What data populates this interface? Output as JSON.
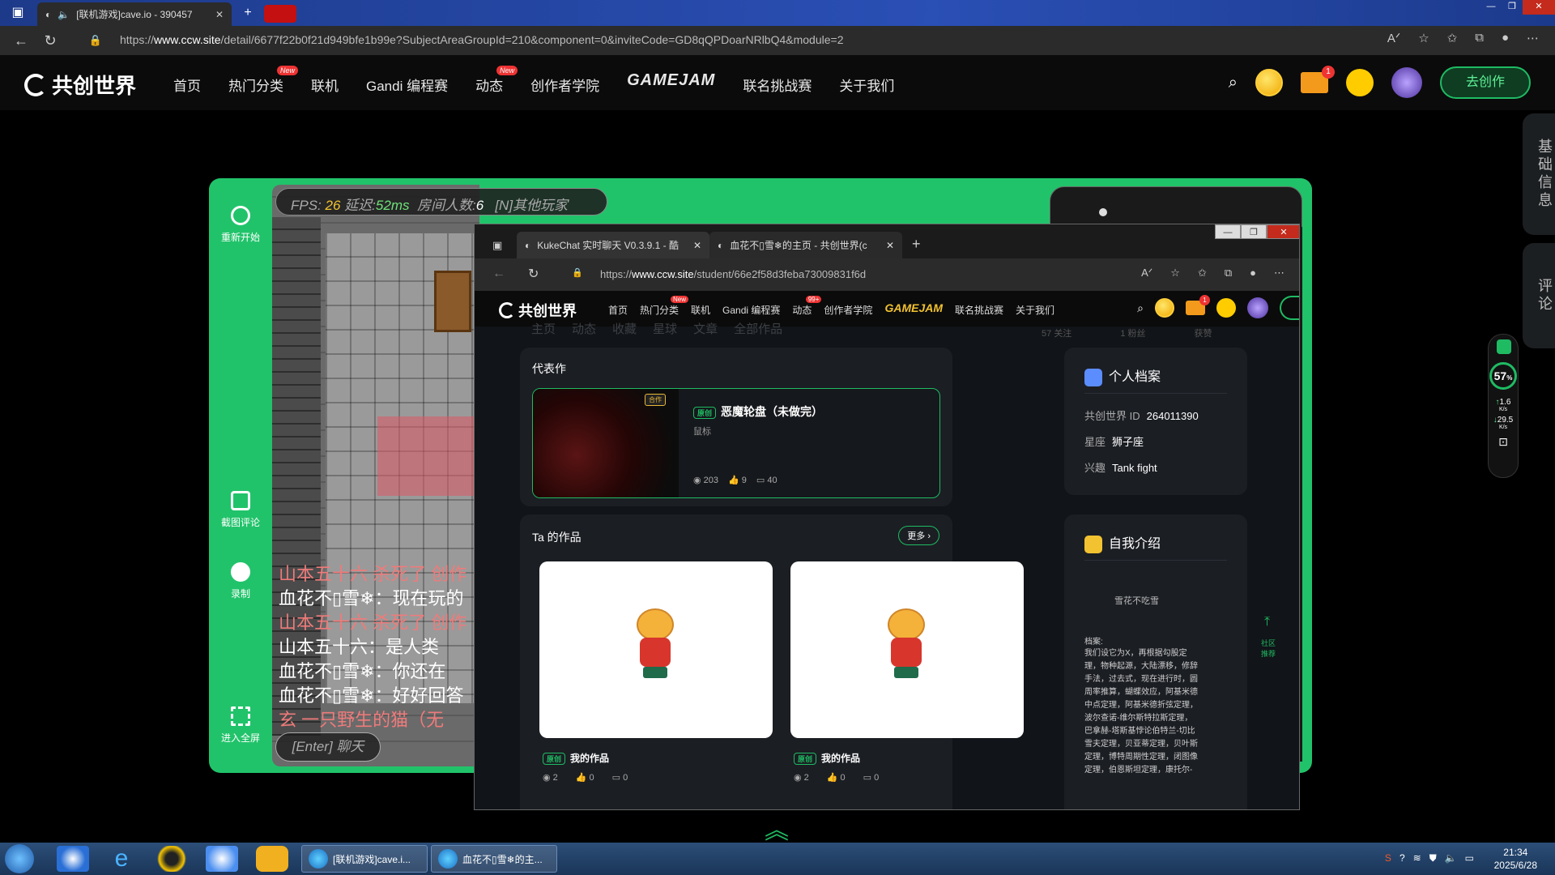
{
  "outer_browser": {
    "tab_title": "[联机游戏]cave.io - 390457",
    "url_prefix": "https://",
    "url_domain": "www.ccw.site",
    "url_path": "/detail/6677f22b0f21d949bfe1b99e?SubjectAreaGroupId=210&component=0&inviteCode=GD8qQPDoarNRlbQ4&module=2"
  },
  "site_header": {
    "logo_text": "共创世界",
    "nav": [
      {
        "label": "首页",
        "badge": ""
      },
      {
        "label": "热门分类",
        "badge": "New"
      },
      {
        "label": "联机",
        "badge": ""
      },
      {
        "label": "Gandi 编程赛",
        "badge": ""
      },
      {
        "label": "动态",
        "badge": "New"
      },
      {
        "label": "创作者学院",
        "badge": ""
      },
      {
        "label": "GAMEJAM",
        "badge": ""
      },
      {
        "label": "联名挑战赛",
        "badge": ""
      },
      {
        "label": "关于我们",
        "badge": ""
      }
    ],
    "mail_count": "1",
    "create_label": "去创作"
  },
  "side_tabs": {
    "basic_info": "基础信息",
    "comments": "评论"
  },
  "game": {
    "tools": [
      {
        "label": "重新开始",
        "icon": "restart-icon"
      },
      {
        "label": "截图评论",
        "icon": "screenshot-icon"
      },
      {
        "label": "录制",
        "icon": "record-icon"
      },
      {
        "label": "进入全屏",
        "icon": "fullscreen-icon"
      }
    ],
    "hud": {
      "fps_label": "FPS:",
      "fps": "26",
      "latency_label": "延迟:",
      "latency": "52ms",
      "room_label": "房间人数:",
      "room_count": "6",
      "other_players": "[N]其他玩家"
    },
    "chat": [
      {
        "text": "山本五十六 杀死了 创作",
        "kill": true
      },
      {
        "text": "血花不▯雪❄：现在玩的",
        "kill": false
      },
      {
        "text": "山本五十六 杀死了 创作",
        "kill": true
      },
      {
        "text": "山本五十六：是人类",
        "kill": false
      },
      {
        "text": "血花不▯雪❄：你还在",
        "kill": false
      },
      {
        "text": "血花不▯雪❄：好好回答",
        "kill": false
      },
      {
        "text": "玄 一只野生的猫（无",
        "kill": true
      }
    ],
    "chat_input": "[Enter] 聊天"
  },
  "inner_browser": {
    "tab1": "KukeChat 实时聊天 V0.3.9.1 - 酷",
    "tab2": "血花不▯雪❄的主页 - 共创世界(c",
    "url_prefix": "https://",
    "url_domain": "www.ccw.site",
    "url_path": "/student/66e2f58d3feba73009831f6d",
    "logo_text": "共创世界",
    "nav": [
      {
        "label": "首页",
        "badge": ""
      },
      {
        "label": "热门分类",
        "badge": "New"
      },
      {
        "label": "联机",
        "badge": ""
      },
      {
        "label": "Gandi 编程赛",
        "badge": ""
      },
      {
        "label": "动态",
        "badge": "99+"
      },
      {
        "label": "创作者学院",
        "badge": ""
      },
      {
        "label": "GAMEJAM",
        "badge": ""
      },
      {
        "label": "联名挑战赛",
        "badge": ""
      },
      {
        "label": "关于我们",
        "badge": ""
      }
    ],
    "mail_count": "1"
  },
  "profile_page": {
    "ghost_tabs": [
      "主页",
      "动态",
      "收藏",
      "星球",
      "文章",
      "全部作品"
    ],
    "ghost_stats": [
      {
        "num": "57",
        "label": "关注"
      },
      {
        "num": "1",
        "label": "粉丝"
      },
      {
        "num": "",
        "label": "获赞"
      }
    ],
    "representative": {
      "title": "代表作",
      "thumb_badge": "合作",
      "tag": "原创",
      "name": "恶魔轮盘（未做完）",
      "category": "鼠标",
      "views": "203",
      "likes": "9",
      "comments": "40"
    },
    "works": {
      "title": "Ta 的作品",
      "more": "更多",
      "items": [
        {
          "tag": "原创",
          "name": "我的作品",
          "views": "2",
          "likes": "0",
          "comments": "0"
        },
        {
          "tag": "原创",
          "name": "我的作品",
          "views": "2",
          "likes": "0",
          "comments": "0"
        }
      ]
    },
    "profile": {
      "title": "个人档案",
      "id_label": "共创世界 ID",
      "id_value": "264011390",
      "zodiac_label": "星座",
      "zodiac_value": "狮子座",
      "hobby_label": "兴趣",
      "hobby_value": "Tank fight"
    },
    "intro": {
      "title": "自我介绍",
      "subtitle": "雪花不吃雪",
      "archive_label": "档案:",
      "text": "我们设它为X，再根据勾股定理，物种起源，大陆漂移，修辞手法，过去式，现在进行时，圆周率推算，蝴蝶效应，阿基米德中点定理，阿基米德折弦定理，波尔查诺-维尔斯特拉斯定理，巴拿赫-塔斯基悖论伯特兰-切比雪夫定理，贝亚蒂定理，贝叶斯定理，博特周期性定理，闭图像定理，伯恩斯坦定理，康托尔-"
    }
  },
  "float_widget": {
    "percent": "57",
    "percent_unit": "%",
    "up": "1.6",
    "up_unit": "K/s",
    "down": "29.5",
    "down_unit": "K/s",
    "top_label": "社区推荐"
  },
  "taskbar": {
    "task1": "[联机游戏]cave.i...",
    "task2": "血花不▯雪❄的主...",
    "time": "21:34",
    "date": "2025/6/28"
  }
}
